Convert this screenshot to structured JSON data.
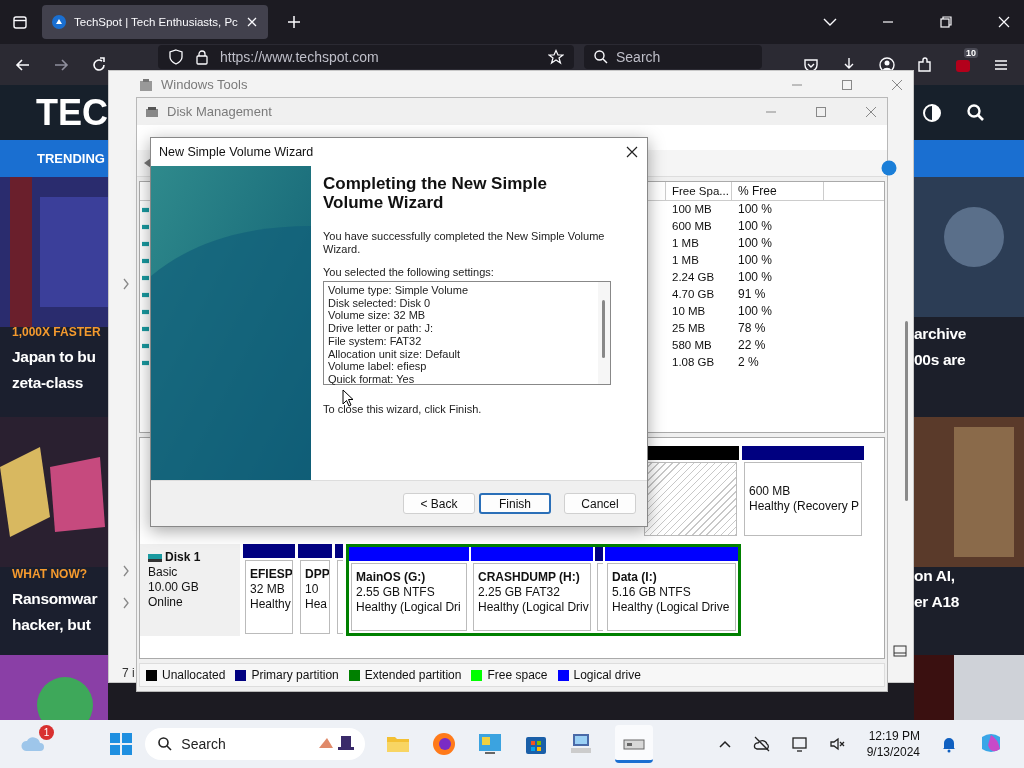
{
  "browser": {
    "tab": {
      "title": "TechSpot | Tech Enthusiasts, Pc",
      "selected": true
    },
    "address": "https://www.techspot.com",
    "search": {
      "placeholder": "Search"
    },
    "extension_badge": "10"
  },
  "site": {
    "logo": "TEC",
    "nav_label": "TRENDING",
    "left_articles": [
      {
        "tag": "1,000X FASTER",
        "lines": [
          "Japan to bu",
          "zeta-class"
        ]
      },
      {
        "tag": "WHAT NOW?",
        "lines": [
          "Ransomwar",
          "hacker, but"
        ]
      }
    ],
    "right_articles": [
      {
        "lines": [
          "archive",
          "00s are"
        ]
      },
      {
        "lines": [
          "on AI,",
          "er A18"
        ]
      }
    ]
  },
  "windows_tools": {
    "title": "Windows Tools",
    "status": "7 i"
  },
  "disk_management": {
    "title": "Disk Management",
    "columns": [
      "Free Spa...",
      "% Free"
    ],
    "rows": [
      {
        "free": "100 MB",
        "pct": "100 %"
      },
      {
        "free": "600 MB",
        "pct": "100 %"
      },
      {
        "free": "1 MB",
        "pct": "100 %"
      },
      {
        "free": "1 MB",
        "pct": "100 %"
      },
      {
        "free": "2.24 GB",
        "pct": "100 %"
      },
      {
        "free": "4.70 GB",
        "pct": "91 %"
      },
      {
        "free": "10 MB",
        "pct": "100 %"
      },
      {
        "free": "25 MB",
        "pct": "78 %"
      },
      {
        "free": "580 MB",
        "pct": "22 %"
      },
      {
        "free": "1.08 GB",
        "pct": "2 %"
      }
    ],
    "disk0": {
      "partitions": [
        {
          "kind": "unallocated",
          "color": "#000000"
        },
        {
          "kind": "partition",
          "color": "#000080",
          "lines": [
            "600 MB",
            "Healthy (Recovery P"
          ]
        }
      ]
    },
    "disk1": {
      "name": "Disk 1",
      "type": "Basic",
      "size": "10.00 GB",
      "status": "Online",
      "primary": [
        {
          "color": "#000080",
          "title": "EFIESP",
          "lines": [
            "32 MB",
            "Healthy"
          ]
        },
        {
          "color": "#000080",
          "title": "DPP",
          "lines": [
            "10",
            "Hea"
          ]
        },
        {
          "color": "#000080"
        }
      ],
      "extended": [
        {
          "color": "#0000ff",
          "title": "MainOS  (G:)",
          "lines": [
            "2.55 GB NTFS",
            "Healthy (Logical Dri"
          ]
        },
        {
          "color": "#0000ff",
          "title": "CRASHDUMP  (H:)",
          "lines": [
            "2.25 GB FAT32",
            "Healthy (Logical Driv"
          ]
        },
        {
          "color": "#000080"
        },
        {
          "color": "#0000ff",
          "title": "Data  (I:)",
          "lines": [
            "5.16 GB NTFS",
            "Healthy (Logical Drive"
          ]
        }
      ]
    },
    "legend": [
      {
        "label": "Unallocated",
        "color": "#000000"
      },
      {
        "label": "Primary partition",
        "color": "#000080"
      },
      {
        "label": "Extended partition",
        "color": "#008000"
      },
      {
        "label": "Free space",
        "color": "#00ff00"
      },
      {
        "label": "Logical drive",
        "color": "#0000ff"
      }
    ]
  },
  "wizard": {
    "title": "New Simple Volume Wizard",
    "heading": "Completing the New Simple Volume Wizard",
    "intro": "You have successfully completed the New Simple Volume Wizard.",
    "settings_label": "You selected the following settings:",
    "settings": [
      "Volume type: Simple Volume",
      "Disk selected: Disk 0",
      "Volume size: 32 MB",
      "Drive letter or path: J:",
      "File system: FAT32",
      "Allocation unit size: Default",
      "Volume label: efiesp",
      "Quick format: Yes"
    ],
    "closing": "To close this wizard, click Finish.",
    "buttons": [
      {
        "label": "< Back",
        "default": false
      },
      {
        "label": "Finish",
        "default": true
      },
      {
        "label": "Cancel",
        "default": false
      }
    ]
  },
  "taskbar": {
    "weather_badge": "1",
    "search": {
      "placeholder": "Search"
    },
    "time": "12:19 PM",
    "date": "9/13/2024"
  }
}
